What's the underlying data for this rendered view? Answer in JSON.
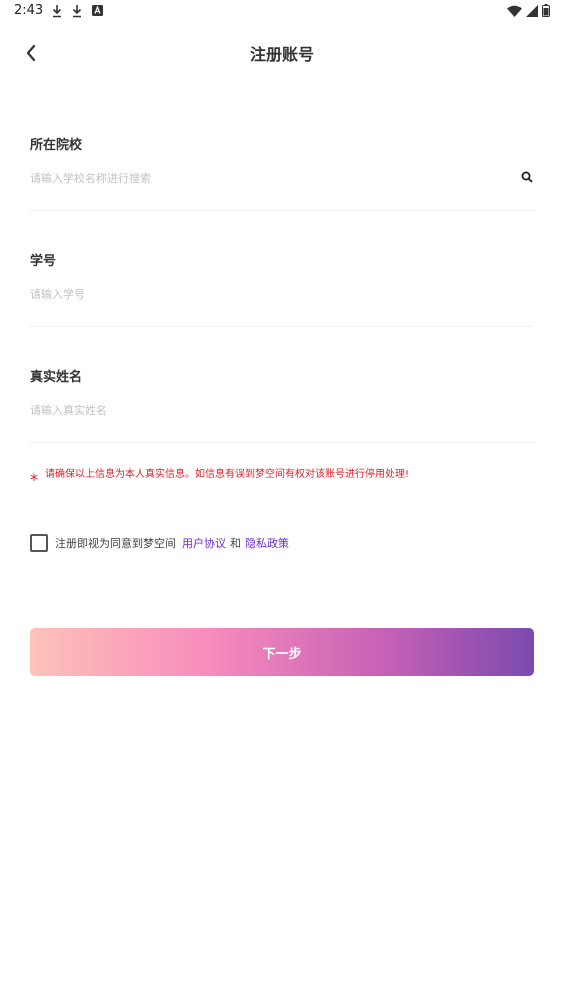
{
  "status_bar": {
    "time": "2:43",
    "left_icons": [
      "download-icon",
      "download-icon",
      "app-icon"
    ],
    "right_icons": [
      "wifi-icon",
      "signal-icon",
      "battery-icon"
    ]
  },
  "nav": {
    "title": "注册账号",
    "back_icon": "chevron-left-icon"
  },
  "form": {
    "school": {
      "label": "所在院校",
      "placeholder": "请输入学校名称进行搜索",
      "value": ""
    },
    "student_id": {
      "label": "学号",
      "placeholder": "请输入学号",
      "value": ""
    },
    "real_name": {
      "label": "真实姓名",
      "placeholder": "请输入真实姓名",
      "value": ""
    }
  },
  "warning": {
    "star": "*",
    "text": "请确保以上信息为本人真实信息。如信息有误到梦空间有权对该账号进行停用处理!"
  },
  "agreement": {
    "checked": false,
    "prefix": "注册即视为同意到梦空间",
    "user_agreement": "用户协议",
    "and": "和",
    "privacy_policy": "隐私政策"
  },
  "next_button": {
    "label": "下一步"
  },
  "colors": {
    "warning": "#d9232c",
    "link": "#6a2bd0",
    "gradient": [
      "#fdc3b8",
      "#f88cbd",
      "#c761b6",
      "#7b4aaf"
    ]
  }
}
